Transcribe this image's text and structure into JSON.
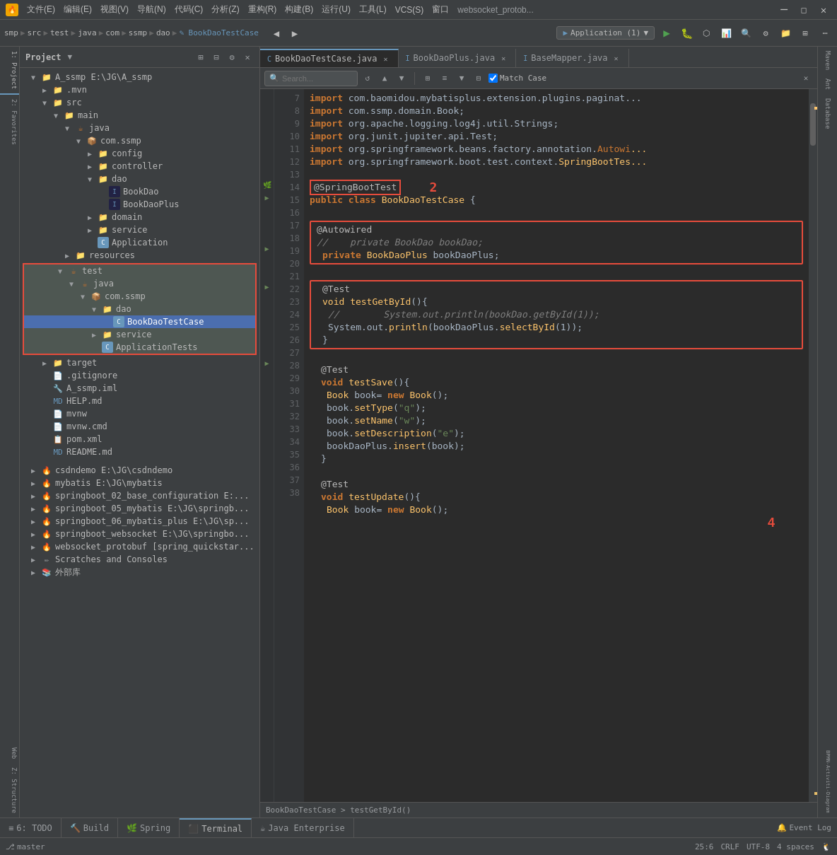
{
  "titlebar": {
    "icon": "🔥",
    "projectName": "websocket_protobu",
    "menus": [
      "文件(E)",
      "编辑(E)",
      "视图(V)",
      "导航(N)",
      "代码(C)",
      "分析(Z)",
      "重构(R)",
      "构建(B)",
      "运行(U)",
      "工具(L)",
      "VCS(S)",
      "窗口",
      "websocket_protob..."
    ]
  },
  "breadcrumb": {
    "items": [
      "smp",
      "src",
      "test",
      "java",
      "com",
      "ssmp",
      "dao",
      "BookDaoTestCase"
    ]
  },
  "toolbar": {
    "runConfig": "Application (1)",
    "runBtn": "▶",
    "debugBtn": "🐛"
  },
  "tabs": {
    "editor": [
      {
        "label": "BookDaoTestCase.java",
        "active": true,
        "icon": "C"
      },
      {
        "label": "BookDaoPlus.java",
        "active": false,
        "icon": "I"
      },
      {
        "label": "BaseMapper.java",
        "active": false,
        "icon": "I"
      }
    ]
  },
  "fileTree": {
    "items": [
      {
        "indent": 0,
        "type": "project-root",
        "label": "A_ssmp E:\\JG\\A_ssmp",
        "icon": "folder"
      },
      {
        "indent": 1,
        "type": "folder",
        "label": ".mvn",
        "icon": "folder"
      },
      {
        "indent": 1,
        "type": "folder",
        "label": "src",
        "icon": "folder",
        "open": true
      },
      {
        "indent": 2,
        "type": "folder",
        "label": "main",
        "icon": "folder",
        "open": true
      },
      {
        "indent": 3,
        "type": "folder",
        "label": "java",
        "icon": "folder",
        "open": true
      },
      {
        "indent": 4,
        "type": "folder",
        "label": "com.ssmp",
        "icon": "folder",
        "open": true
      },
      {
        "indent": 5,
        "type": "folder",
        "label": "config",
        "icon": "folder"
      },
      {
        "indent": 5,
        "type": "folder",
        "label": "controller",
        "icon": "folder"
      },
      {
        "indent": 5,
        "type": "folder",
        "label": "dao",
        "icon": "folder",
        "open": true
      },
      {
        "indent": 6,
        "type": "interface",
        "label": "BookDao",
        "icon": "interface"
      },
      {
        "indent": 6,
        "type": "interface",
        "label": "BookDaoPlus",
        "icon": "interface"
      },
      {
        "indent": 5,
        "type": "folder",
        "label": "domain",
        "icon": "folder"
      },
      {
        "indent": 5,
        "type": "folder",
        "label": "service",
        "icon": "folder"
      },
      {
        "indent": 5,
        "type": "class",
        "label": "Application",
        "icon": "class"
      },
      {
        "indent": 3,
        "type": "folder",
        "label": "resources",
        "icon": "folder"
      },
      {
        "indent": 2,
        "type": "folder",
        "label": "test",
        "icon": "folder",
        "open": true,
        "highlight": true
      },
      {
        "indent": 3,
        "type": "folder",
        "label": "java",
        "icon": "folder",
        "open": true,
        "highlight": true
      },
      {
        "indent": 4,
        "type": "folder",
        "label": "com.ssmp",
        "icon": "folder",
        "open": true,
        "highlight": true
      },
      {
        "indent": 5,
        "type": "folder",
        "label": "dao",
        "icon": "folder",
        "open": true,
        "highlight": true
      },
      {
        "indent": 6,
        "type": "class",
        "label": "BookDaoTestCase",
        "icon": "class",
        "selected": true
      },
      {
        "indent": 5,
        "type": "folder",
        "label": "service",
        "icon": "folder"
      },
      {
        "indent": 5,
        "type": "class",
        "label": "ApplicationTests",
        "icon": "class"
      },
      {
        "indent": 1,
        "type": "folder",
        "label": "target",
        "icon": "folder"
      },
      {
        "indent": 1,
        "type": "file",
        "label": ".gitignore",
        "icon": "file"
      },
      {
        "indent": 1,
        "type": "iml",
        "label": "A_ssmp.iml",
        "icon": "iml"
      },
      {
        "indent": 1,
        "type": "md",
        "label": "HELP.md",
        "icon": "md"
      },
      {
        "indent": 1,
        "type": "file",
        "label": "mvnw",
        "icon": "file"
      },
      {
        "indent": 1,
        "type": "file",
        "label": "mvnw.cmd",
        "icon": "file"
      },
      {
        "indent": 1,
        "type": "xml",
        "label": "pom.xml",
        "icon": "xml"
      },
      {
        "indent": 1,
        "type": "md",
        "label": "README.md",
        "icon": "md"
      }
    ],
    "otherProjects": [
      {
        "label": "csdndemo E:\\JG\\csdndemo"
      },
      {
        "label": "mybatis E:\\JG\\mybatis"
      },
      {
        "label": "springboot_02_base_configuration E:..."
      },
      {
        "label": "springboot_05_mybatis E:\\JG\\springb..."
      },
      {
        "label": "springboot_06_mybatis_plus E:\\JG\\sp..."
      },
      {
        "label": "springboot_websocket E:\\JG\\springbo..."
      },
      {
        "label": "websocket_protobuf [spring_quickstar..."
      },
      {
        "label": "Scratches and Consoles"
      },
      {
        "label": "外部库"
      }
    ]
  },
  "code": {
    "lines": [
      {
        "num": 7,
        "content": "import com.baomidou.mybatisplus.extension.plugins.paginat...",
        "type": "import"
      },
      {
        "num": 8,
        "content": "import com.ssmp.domain.Book;",
        "type": "import"
      },
      {
        "num": 9,
        "content": "import org.apache.logging.log4j.util.Strings;",
        "type": "import"
      },
      {
        "num": 10,
        "content": "import org.junit.jupiter.api.Test;",
        "type": "import"
      },
      {
        "num": 11,
        "content": "import org.springframework.beans.factory.annotation.Autowi...",
        "type": "import"
      },
      {
        "num": 12,
        "content": "import org.springframework.boot.test.context.SpringBootTes...",
        "type": "import"
      },
      {
        "num": 13,
        "content": "",
        "type": "blank"
      },
      {
        "num": 14,
        "content": "@SpringBootTest",
        "type": "annotation",
        "redbox": true
      },
      {
        "num": 15,
        "content": "public class BookDaoTestCase {",
        "type": "class-decl"
      },
      {
        "num": 16,
        "content": "",
        "type": "blank"
      },
      {
        "num": 17,
        "content": "    @Autowired",
        "type": "annotation"
      },
      {
        "num": 18,
        "content": "//    private BookDao bookDao;",
        "type": "comment"
      },
      {
        "num": 19,
        "content": "    private BookDaoPlus bookDaoPlus;",
        "type": "field"
      },
      {
        "num": 20,
        "content": "",
        "type": "blank"
      },
      {
        "num": 21,
        "content": "    @Test",
        "type": "annotation"
      },
      {
        "num": 22,
        "content": "    void testGetById(){",
        "type": "method"
      },
      {
        "num": 23,
        "content": "//        System.out.println(bookDao.getById(1));",
        "type": "comment"
      },
      {
        "num": 24,
        "content": "        System.out.println(bookDaoPlus.selectById(1));",
        "type": "code"
      },
      {
        "num": 25,
        "content": "    }",
        "type": "code"
      },
      {
        "num": 26,
        "content": "",
        "type": "blank"
      },
      {
        "num": 27,
        "content": "    @Test",
        "type": "annotation"
      },
      {
        "num": 28,
        "content": "    void testSave(){",
        "type": "method"
      },
      {
        "num": 29,
        "content": "        Book book= new Book();",
        "type": "code"
      },
      {
        "num": 30,
        "content": "        book.setType(\"q\");",
        "type": "code"
      },
      {
        "num": 31,
        "content": "        book.setName(\"w\");",
        "type": "code"
      },
      {
        "num": 32,
        "content": "        book.setDescription(\"e\");",
        "type": "code"
      },
      {
        "num": 33,
        "content": "        bookDaoPlus.insert(book);",
        "type": "code"
      },
      {
        "num": 34,
        "content": "    }",
        "type": "code"
      },
      {
        "num": 35,
        "content": "",
        "type": "blank"
      },
      {
        "num": 36,
        "content": "    @Test",
        "type": "annotation"
      },
      {
        "num": 37,
        "content": "    void testUpdate(){",
        "type": "method"
      },
      {
        "num": 38,
        "content": "        Book book= new Book();",
        "type": "code"
      }
    ]
  },
  "status": {
    "line": "25:6",
    "lineEnding": "CRLF",
    "encoding": "UTF-8",
    "indent": "4 spaces"
  },
  "bottomTabs": [
    "6: TODO",
    "Build",
    "Spring",
    "Terminal",
    "Java Enterprise"
  ],
  "breadcrumbBottom": "BookDaoTestCase > testGetById()",
  "rightTabs": [
    "Maven",
    "Ant",
    "Database",
    "BPMN-Activiti-Diagram"
  ],
  "sidebarLabels": [
    "1: Project",
    "2: Favorites",
    "Web",
    "Z: Structure"
  ]
}
